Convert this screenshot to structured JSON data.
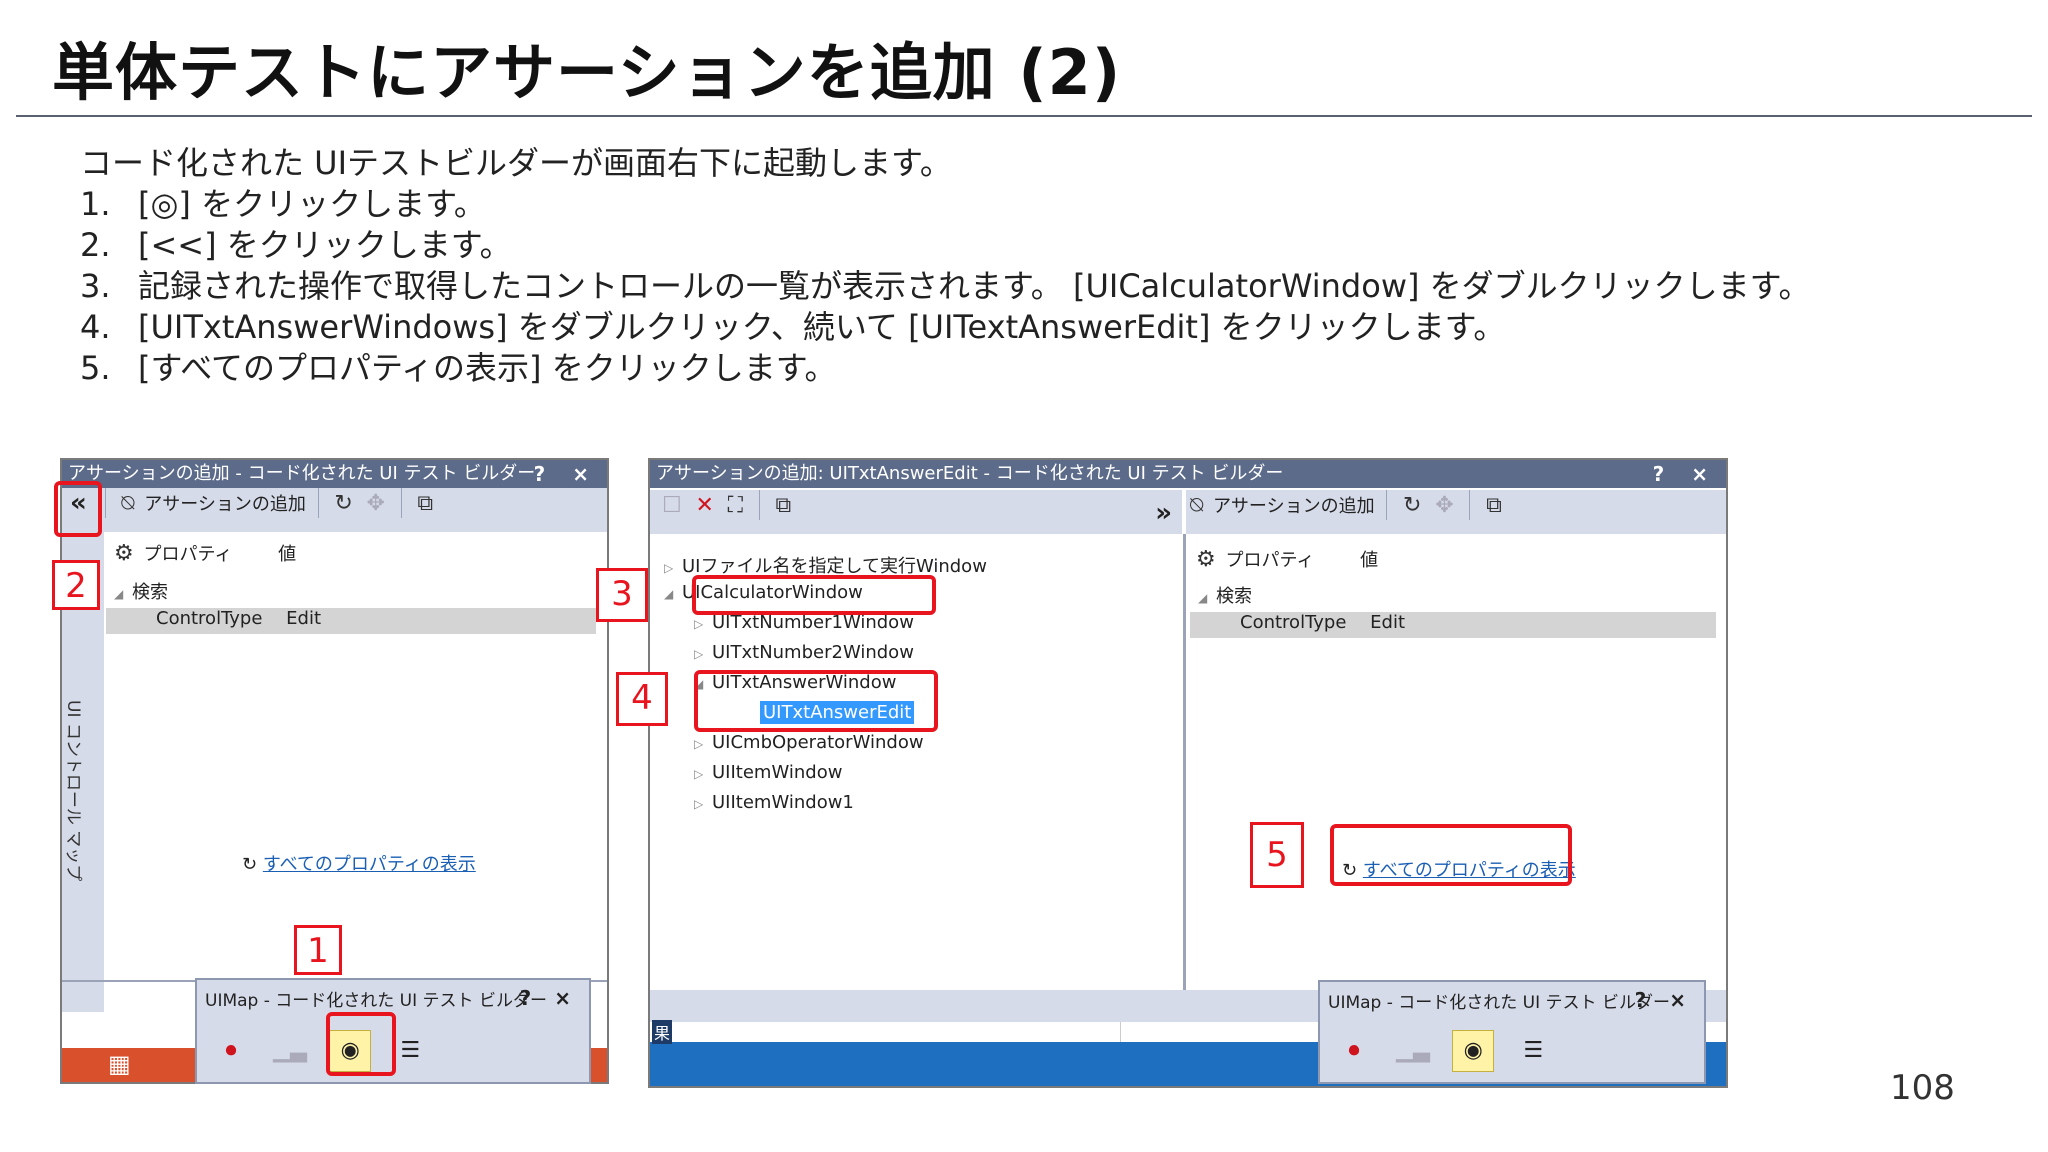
{
  "slide": {
    "title": "単体テストにアサーションを追加 (2)",
    "intro": "コード化された UIテストビルダーが画面右下に起動します。",
    "steps": [
      {
        "num": "1.",
        "text": "[◎] をクリックします。"
      },
      {
        "num": "2.",
        "text": "[<<] をクリックします。"
      },
      {
        "num": "3.",
        "text": "記録された操作で取得したコントロールの一覧が表示されます。 [UICalculatorWindow] をダブルクリックします。"
      },
      {
        "num": "4.",
        "text": "[UITxtAnswerWindows] をダブルクリック、続いて [UITextAnswerEdit] をクリックします。"
      },
      {
        "num": "5.",
        "text": "[すべてのプロパティの表示] をクリックします。"
      }
    ],
    "page_number": "108"
  },
  "left_shot": {
    "title": "アサーションの追加 - コード化された UI テスト ビルダー",
    "title_controls": "? ×",
    "collapse": "«",
    "add_assertion": "アサーションの追加",
    "col_property": "プロパティ",
    "col_value": "値",
    "group": "検索",
    "prop_name": "ControlType",
    "prop_value": "Edit",
    "side_label": "UI コントロール マップ",
    "show_all": "すべてのプロパティの表示",
    "mini_title": "UIMap - コード化された UI テスト ビルダー",
    "mini_controls": "? ×"
  },
  "right_shot": {
    "title": "アサーションの追加: UITxtAnswerEdit - コード化された UI テスト ビルダー",
    "title_controls": "? ×",
    "expand": "»",
    "add_assertion": "アサーションの追加",
    "col_property": "プロパティ",
    "col_value": "値",
    "group": "検索",
    "prop_name": "ControlType",
    "prop_value": "Edit",
    "tree": [
      "UIファイル名を指定して実行Window",
      "UICalculatorWindow",
      "UITxtNumber1Window",
      "UITxtNumber2Window",
      "UITxtAnswerWindow",
      "UITxtAnswerEdit",
      "UICmbOperatorWindow",
      "UIItemWindow",
      "UIItemWindow1"
    ],
    "show_all": "すべてのプロパティの表示",
    "mini_title": "UIMap - コード化された UI テスト ビルダー",
    "mini_controls": "? ×",
    "status_char": "果"
  },
  "callouts": [
    "1",
    "2",
    "3",
    "4",
    "5"
  ],
  "colors": {
    "accent": "#e8141e",
    "title_bar": "#5c6b8a",
    "toolbar": "#d6dbe9",
    "link": "#1a5fb4"
  },
  "icons": [
    "refresh-icon",
    "record-icon",
    "target-icon",
    "generate-code-icon",
    "copy-icon",
    "delete-icon",
    "gear-icon"
  ]
}
